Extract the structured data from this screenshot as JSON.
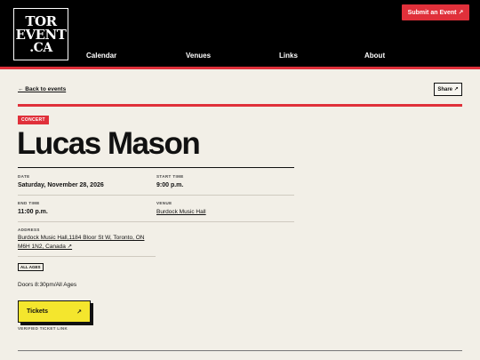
{
  "logo": {
    "line1": "TOR",
    "line2": "EVENT",
    "line3": ".CA"
  },
  "nav": {
    "items": [
      "Calendar",
      "Venues",
      "Links",
      "About"
    ],
    "submit_label": "Submit an Event ↗"
  },
  "toolbar": {
    "back_label": "← Back to events",
    "share_label": "Share ↗"
  },
  "event": {
    "category": "CONCERT",
    "title": "Lucas Mason",
    "date_label": "DATE",
    "date": "Saturday, November 28, 2026",
    "start_label": "START TIME",
    "start_time": "9:00 p.m.",
    "end_label": "END TIME",
    "end_time": "11:00 p.m.",
    "venue_label": "VENUE",
    "venue": "Burdock Music Hall",
    "address_label": "ADDRESS",
    "address": "Burdock Music Hall,1184 Bloor St W, Toronto, ON M6H 1N2, Canada ↗",
    "age_badge": "ALL AGES",
    "doors": "Doors 8:30pm/All Ages",
    "tickets_label": "Tickets",
    "tickets_icon": "↗",
    "verified_label": "VERIFIED TICKET LINK"
  },
  "colors": {
    "header_bg": "#000000",
    "accent_red": "#e0303a",
    "page_bg": "#f2efe7",
    "ticket_yellow": "#f4e62d"
  }
}
